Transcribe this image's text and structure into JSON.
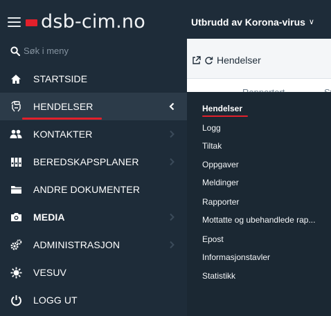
{
  "topbar": {
    "brand": "dsb-cim.no",
    "event_selector": "Utbrudd av Korona-virus",
    "event_chevron": "∨",
    "brand_color": "#e3202b"
  },
  "sidebar": {
    "search_placeholder": "Søk i meny",
    "items": [
      {
        "label": "STARTSIDE",
        "icon": "home-icon"
      },
      {
        "label": "HENDELSER",
        "icon": "incident-icon"
      },
      {
        "label": "KONTAKTER",
        "icon": "contacts-icon"
      },
      {
        "label": "BEREDSKAPSPLANER",
        "icon": "binders-icon"
      },
      {
        "label": "ANDRE DOKUMENTER",
        "icon": "folder-icon"
      },
      {
        "label": "MEDIA",
        "icon": "camera-icon"
      },
      {
        "label": "ADMINISTRASJON",
        "icon": "cogs-icon"
      },
      {
        "label": "VESUV",
        "icon": "volcano-icon"
      },
      {
        "label": "LOGG UT",
        "icon": "power-icon"
      }
    ]
  },
  "main": {
    "breadcrumb": "Hendelser",
    "table_headers": [
      "Rapportert",
      "St"
    ]
  },
  "submenu": {
    "items": [
      "Hendelser",
      "Logg",
      "Tiltak",
      "Oppgaver",
      "Meldinger",
      "Rapporter",
      "Mottatte og ubehandlede rap...",
      "Epost",
      "Informasjonstavler",
      "Statistikk"
    ]
  }
}
